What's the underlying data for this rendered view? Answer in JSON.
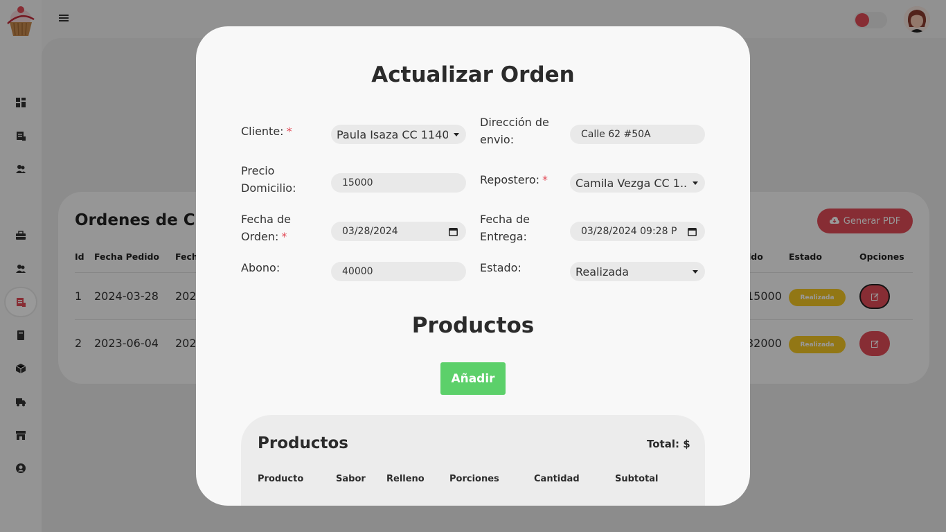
{
  "colors": {
    "accent": "#e24b57",
    "success": "#5cd06a",
    "badge": "#f3c623"
  },
  "header": {
    "menu_icon": "hamburger-icon",
    "logo": "cupcake-logo",
    "theme_toggle": "toggle-switch",
    "avatar": "user-avatar"
  },
  "sidebar": {
    "items": [
      {
        "icon": "dashboard-icon"
      },
      {
        "icon": "receipt-icon"
      },
      {
        "icon": "users-icon"
      },
      {
        "icon": "briefcase-icon"
      },
      {
        "icon": "user-group-icon"
      },
      {
        "icon": "orders-icon",
        "active": true
      },
      {
        "icon": "book-icon"
      },
      {
        "icon": "box-icon"
      },
      {
        "icon": "truck-icon"
      },
      {
        "icon": "store-icon"
      },
      {
        "icon": "user-circle-icon"
      }
    ]
  },
  "orders": {
    "title": "Ordenes de Cli",
    "pdf_button": "Generar PDF",
    "columns": {
      "id": "Id",
      "fecha_pedido": "Fecha Pedido",
      "fecha_trunc": "Fech",
      "saldo": "ldo",
      "estado": "Estado",
      "opciones": "Opciones"
    },
    "rows": [
      {
        "id": "1",
        "fecha": "2024-03-28",
        "fecha2": "202",
        "saldo": "15000",
        "estado": "Realizada"
      },
      {
        "id": "2",
        "fecha": "2023-06-04",
        "fecha2": "202",
        "saldo": "32000",
        "estado": "Realizada"
      }
    ]
  },
  "modal": {
    "title": "Actualizar Orden",
    "fields": {
      "cliente": {
        "label": "Cliente:",
        "value": "Paula Isaza CC 1140..."
      },
      "direccion": {
        "label1": "Dirección de",
        "label2": "envio:",
        "value": "Calle 62 #50A"
      },
      "precio": {
        "label1": "Precio",
        "label2": "Domicilio:",
        "value": "15000"
      },
      "repostero": {
        "label": "Repostero:",
        "value": "Camila Vezga CC 1..."
      },
      "fecha_orden": {
        "label1": "Fecha de",
        "label2": "Orden:",
        "value": "03/28/2024"
      },
      "fecha_entrega": {
        "label1": "Fecha de",
        "label2": "Entrega:",
        "value": "03/28/2024 09:28 P"
      },
      "abono": {
        "label": "Abono:",
        "value": "40000"
      },
      "estado": {
        "label": "Estado:",
        "value": "Realizada"
      }
    },
    "required_mark": "*",
    "products_title": "Productos",
    "add_button": "Añadir",
    "products_table": {
      "title": "Productos",
      "total": "Total: $",
      "columns": [
        "Producto",
        "Sabor",
        "Relleno",
        "Porciones",
        "Cantidad",
        "Subtotal"
      ]
    }
  }
}
